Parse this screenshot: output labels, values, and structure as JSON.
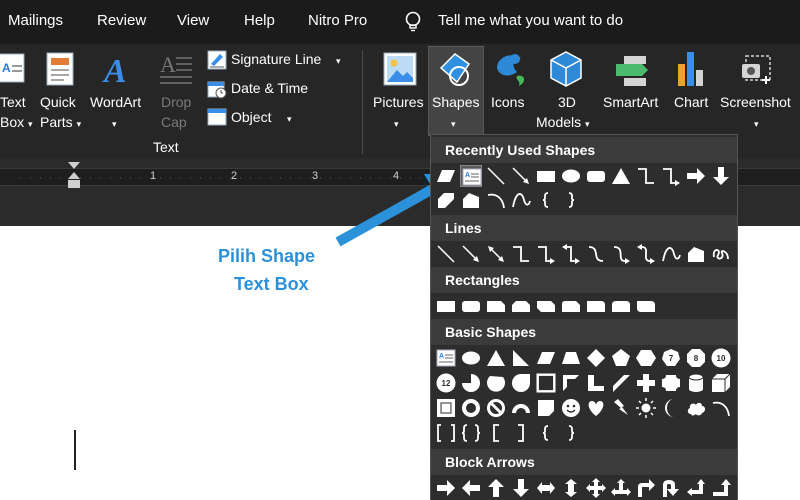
{
  "menu": {
    "items": [
      "Mailings",
      "Review",
      "View",
      "Help",
      "Nitro Pro"
    ],
    "tell_me": "Tell me what you want to do"
  },
  "ribbon": {
    "text_box": {
      "line1": "Text",
      "line2": "Box"
    },
    "quick_parts": {
      "line1": "Quick",
      "line2": "Parts"
    },
    "wordart": "WordArt",
    "drop_cap": {
      "line1": "Drop",
      "line2": "Cap"
    },
    "signature_line": "Signature Line",
    "date_time": "Date & Time",
    "object": "Object",
    "group_text": "Text",
    "pictures": "Pictures",
    "shapes": "Shapes",
    "icons": "Icons",
    "models_3d": {
      "line1": "3D",
      "line2": "Models"
    },
    "smartart": "SmartArt",
    "chart": "Chart",
    "screenshot": "Screenshot"
  },
  "ruler": {
    "numbers": [
      "1",
      "2",
      "3",
      "4"
    ]
  },
  "callout": {
    "line1": "Pilih Shape",
    "line2": "Text Box"
  },
  "dropdown": {
    "sections": [
      "Recently Used Shapes",
      "Lines",
      "Rectangles",
      "Basic Shapes",
      "Block Arrows"
    ],
    "recent_shapes": [
      "parallelogram",
      "text-box",
      "line",
      "arrow-line",
      "rectangle",
      "oval",
      "rounded-rectangle",
      "triangle",
      "elbow-connector",
      "elbow-arrow-connector",
      "right-arrow",
      "down-arrow",
      "rectangle-corner",
      "freeform",
      "arc",
      "curve",
      "left-brace",
      "right-brace"
    ],
    "line_shapes": [
      "line",
      "arrow-line",
      "double-arrow-line",
      "elbow-connector",
      "elbow-arrow-connector",
      "elbow-double-arrow",
      "curved-connector",
      "curved-arrow-connector",
      "curved-double-arrow",
      "curve",
      "freeform",
      "scribble"
    ],
    "rectangle_shapes": [
      "rectangle",
      "rounded-rectangle",
      "snip-single-corner",
      "snip-same-side",
      "snip-diagonal",
      "snip-round",
      "round-single-corner",
      "round-same-side",
      "round-diagonal"
    ],
    "basic_shapes": [
      "text-box",
      "oval",
      "isosceles-triangle",
      "right-triangle",
      "parallelogram",
      "trapezoid",
      "diamond",
      "pentagon",
      "hexagon",
      "heptagon",
      "octagon",
      "decagon",
      "dodecagon",
      "pie",
      "chord",
      "teardrop",
      "frame",
      "half-frame",
      "l-shape",
      "diagonal-stripe",
      "cross",
      "plaque",
      "can",
      "cube",
      "bevel",
      "donut",
      "no-symbol",
      "block-arc",
      "folded-corner",
      "smiley-face",
      "heart",
      "lightning-bolt",
      "sun",
      "moon",
      "cloud",
      "arc",
      "double-bracket",
      "double-brace",
      "left-bracket",
      "right-bracket",
      "left-brace",
      "right-brace"
    ],
    "block_arrows": [
      "right-arrow",
      "left-arrow",
      "up-arrow",
      "down-arrow",
      "left-right-arrow",
      "up-down-arrow",
      "quad-arrow",
      "left-right-up-arrow",
      "bent-arrow",
      "u-turn-arrow",
      "left-up-arrow",
      "bent-up-arrow"
    ],
    "decagon_label": "10",
    "dodecagon_label": "12",
    "heptagon_label": "7",
    "octagon_label": "8"
  },
  "colors": {
    "callout": "#2b91d8",
    "ribbon_bg": "#262626",
    "menu_bg": "#1b1b1b"
  }
}
